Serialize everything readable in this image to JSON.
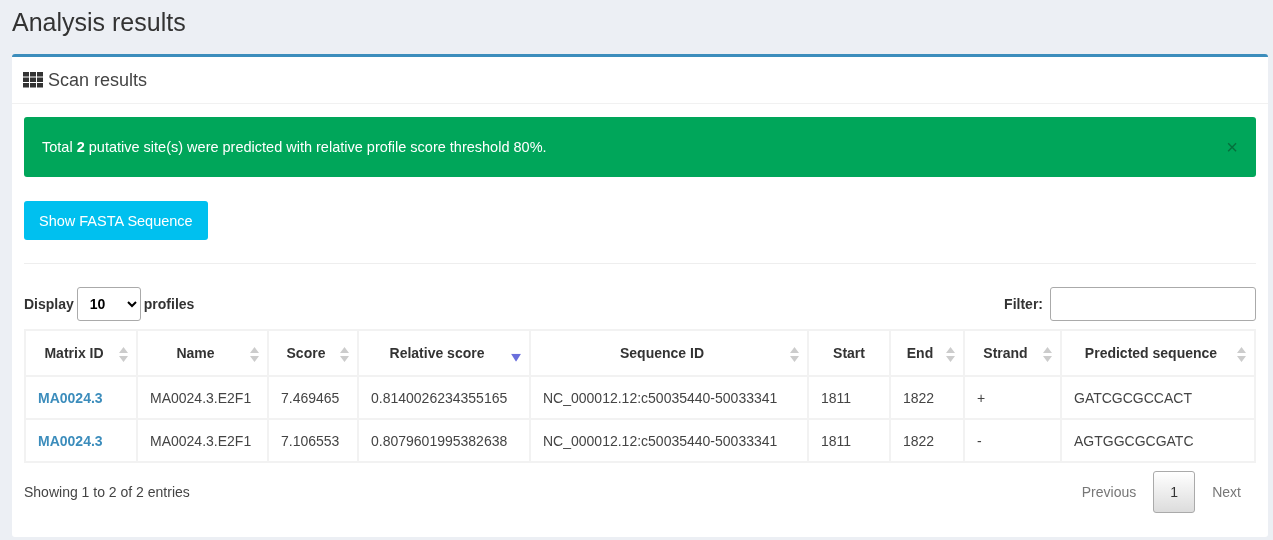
{
  "page_title": "Analysis results",
  "card": {
    "title": "Scan results",
    "alert": {
      "message": "Total **2** putative site(s) were predicted with relative profile score threshold 80%.",
      "close": "×"
    },
    "fasta_button": "Show FASTA Sequence",
    "length_control": {
      "prefix": "Display",
      "value": "10",
      "suffix": "profiles"
    },
    "filter": {
      "label": "Filter:"
    },
    "table": {
      "columns": [
        {
          "label": "Matrix ID",
          "sortable": true,
          "sorted_descending": false
        },
        {
          "label": "Name",
          "sortable": true,
          "sorted_descending": false
        },
        {
          "label": "Score",
          "sortable": true,
          "sorted_descending": false
        },
        {
          "label": "Relative score",
          "sortable": true,
          "sorted_descending": true
        },
        {
          "label": "Sequence ID",
          "sortable": true,
          "sorted_descending": false
        },
        {
          "label": "Start",
          "sortable": false,
          "sorted_descending": false
        },
        {
          "label": "End",
          "sortable": true,
          "sorted_descending": false
        },
        {
          "label": "Strand",
          "sortable": true,
          "sorted_descending": false
        },
        {
          "label": "Predicted sequence",
          "sortable": true,
          "sorted_descending": false
        }
      ],
      "rows": [
        [
          "MA0024.3",
          "MA0024.3.E2F1",
          "7.469465",
          "0.8140026234355165",
          "NC_000012.12:c50035440-50033341",
          "1811",
          "1822",
          "+",
          "GATCGCGCCACT"
        ],
        [
          "MA0024.3",
          "MA0024.3.E2F1",
          "7.106553",
          "0.8079601995382638",
          "NC_000012.12:c50035440-50033341",
          "1811",
          "1822",
          "-",
          "AGTGGCGCGATC"
        ]
      ]
    },
    "info": "Showing 1 to 2 of 2 entries",
    "pagination": [
      {
        "label": "Previous",
        "kind": "nav",
        "selected": false
      },
      {
        "label": "1",
        "kind": "page",
        "selected": true
      },
      {
        "label": "Next",
        "kind": "nav",
        "selected": false
      }
    ]
  }
}
